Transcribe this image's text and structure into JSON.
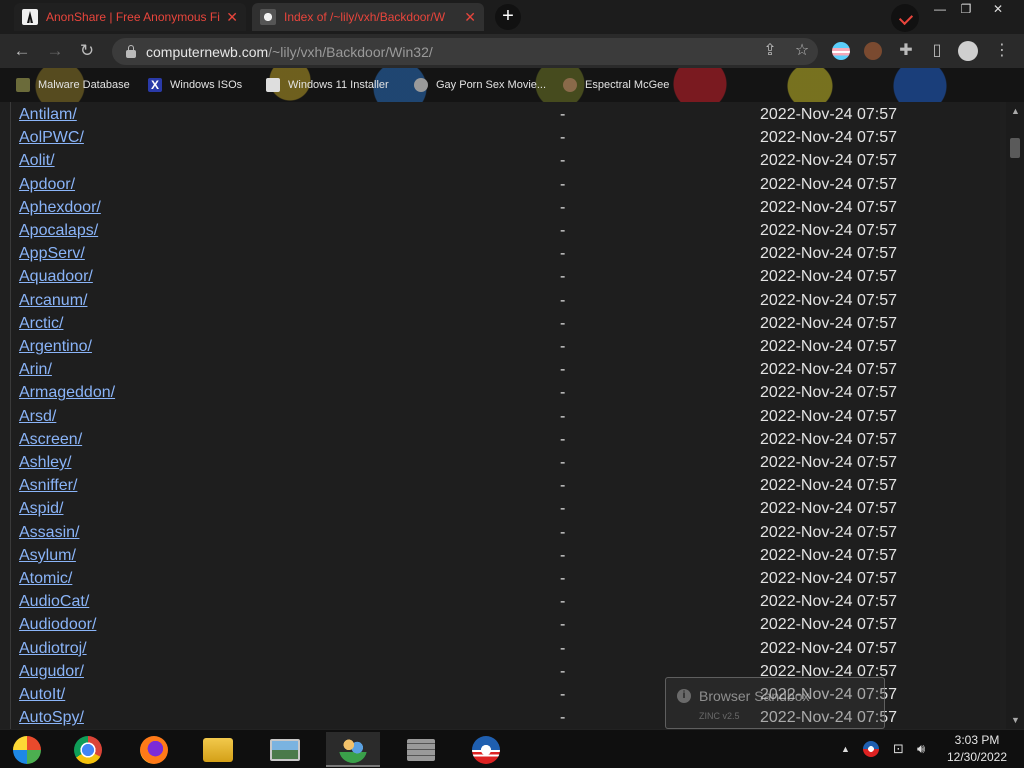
{
  "tabs": [
    {
      "title": "AnonShare | Free Anonymous File",
      "favicon": "anonshare-icon"
    },
    {
      "title": "Index of /~lily/vxh/Backdoor/W",
      "favicon": "dot-icon"
    }
  ],
  "address": {
    "host": "computernewb.com",
    "path": "/~lily/vxh/Backdoor/Win32/"
  },
  "bookmarks": [
    {
      "label": "Malware Database",
      "icon": "shield-icon"
    },
    {
      "label": "Windows ISOs",
      "icon": "x-icon"
    },
    {
      "label": "Windows 11 Installer",
      "icon": "page-icon"
    },
    {
      "label": "Gay Porn Sex Movie...",
      "icon": "globe-icon"
    },
    {
      "label": "Espectral McGee",
      "icon": "avatar-icon"
    }
  ],
  "listing": {
    "rows": [
      {
        "name": "Antilam/",
        "size": "-",
        "date": "2022-Nov-24 07:57"
      },
      {
        "name": "AolPWC/",
        "size": "-",
        "date": "2022-Nov-24 07:57"
      },
      {
        "name": "Aolit/",
        "size": "-",
        "date": "2022-Nov-24 07:57"
      },
      {
        "name": "Apdoor/",
        "size": "-",
        "date": "2022-Nov-24 07:57"
      },
      {
        "name": "Aphexdoor/",
        "size": "-",
        "date": "2022-Nov-24 07:57"
      },
      {
        "name": "Apocalaps/",
        "size": "-",
        "date": "2022-Nov-24 07:57"
      },
      {
        "name": "AppServ/",
        "size": "-",
        "date": "2022-Nov-24 07:57"
      },
      {
        "name": "Aquadoor/",
        "size": "-",
        "date": "2022-Nov-24 07:57"
      },
      {
        "name": "Arcanum/",
        "size": "-",
        "date": "2022-Nov-24 07:57"
      },
      {
        "name": "Arctic/",
        "size": "-",
        "date": "2022-Nov-24 07:57"
      },
      {
        "name": "Argentino/",
        "size": "-",
        "date": "2022-Nov-24 07:57"
      },
      {
        "name": "Arin/",
        "size": "-",
        "date": "2022-Nov-24 07:57"
      },
      {
        "name": "Armageddon/",
        "size": "-",
        "date": "2022-Nov-24 07:57"
      },
      {
        "name": "Arsd/",
        "size": "-",
        "date": "2022-Nov-24 07:57"
      },
      {
        "name": "Ascreen/",
        "size": "-",
        "date": "2022-Nov-24 07:57"
      },
      {
        "name": "Ashley/",
        "size": "-",
        "date": "2022-Nov-24 07:57"
      },
      {
        "name": "Asniffer/",
        "size": "-",
        "date": "2022-Nov-24 07:57"
      },
      {
        "name": "Aspid/",
        "size": "-",
        "date": "2022-Nov-24 07:57"
      },
      {
        "name": "Assasin/",
        "size": "-",
        "date": "2022-Nov-24 07:57"
      },
      {
        "name": "Asylum/",
        "size": "-",
        "date": "2022-Nov-24 07:57"
      },
      {
        "name": "Atomic/",
        "size": "-",
        "date": "2022-Nov-24 07:57"
      },
      {
        "name": "AudioCat/",
        "size": "-",
        "date": "2022-Nov-24 07:57"
      },
      {
        "name": "Audiodoor/",
        "size": "-",
        "date": "2022-Nov-24 07:57"
      },
      {
        "name": "Audiotroj/",
        "size": "-",
        "date": "2022-Nov-24 07:57"
      },
      {
        "name": "Augudor/",
        "size": "-",
        "date": "2022-Nov-24 07:57"
      },
      {
        "name": "AutoIt/",
        "size": "-",
        "date": "2022-Nov-24 07:57"
      },
      {
        "name": "AutoSpy/",
        "size": "-",
        "date": "2022-Nov-24 07:57"
      }
    ]
  },
  "notification": {
    "title": "Browser Sandbox",
    "subtitle": "ZINC v2.5"
  },
  "taskbar": {
    "apps": [
      "start-orb-icon",
      "chrome-icon",
      "firefox-icon",
      "file-explorer-icon",
      "photo-viewer-icon",
      "network-users-icon",
      "firewall-icon",
      "obama-icon"
    ]
  },
  "clock": {
    "time": "3:03 PM",
    "date": "12/30/2022"
  },
  "colors": {
    "link": "#8ab4f8",
    "tab_title": "#e8453c",
    "page_bg": "#1e1e1e"
  }
}
